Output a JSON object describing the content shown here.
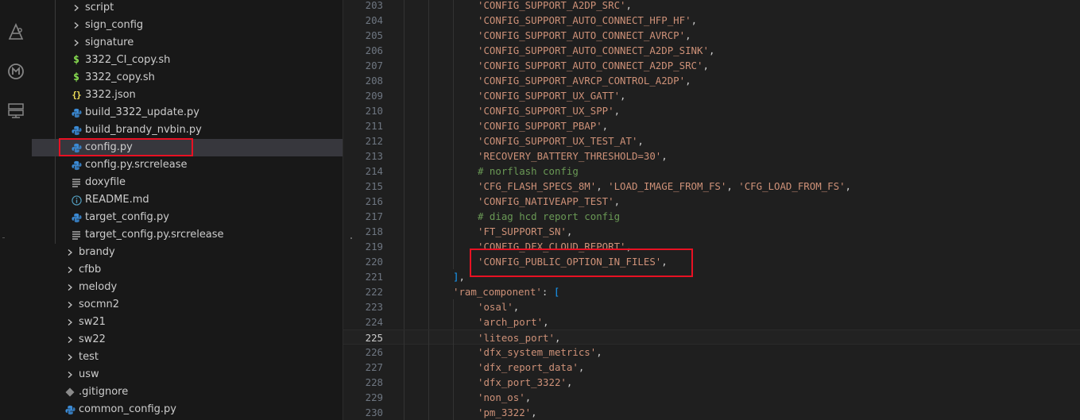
{
  "activity_bar": {
    "icons": [
      "source-control-graph-icon",
      "codebuddy-icon",
      "remote-explorer-icon"
    ]
  },
  "explorer": {
    "items": [
      {
        "label": "script",
        "type": "folder",
        "level": 2,
        "expanded": false
      },
      {
        "label": "sign_config",
        "type": "folder",
        "level": 2,
        "expanded": false
      },
      {
        "label": "signature",
        "type": "folder",
        "level": 2,
        "expanded": false
      },
      {
        "label": "3322_CI_copy.sh",
        "type": "shell",
        "level": 2
      },
      {
        "label": "3322_copy.sh",
        "type": "shell",
        "level": 2
      },
      {
        "label": "3322.json",
        "type": "json",
        "level": 2
      },
      {
        "label": "build_3322_update.py",
        "type": "python",
        "level": 2
      },
      {
        "label": "build_brandy_nvbin.py",
        "type": "python",
        "level": 2
      },
      {
        "label": "config.py",
        "type": "python",
        "level": 2,
        "selected": true
      },
      {
        "label": "config.py.srcrelease",
        "type": "python",
        "level": 2
      },
      {
        "label": "doxyfile",
        "type": "text",
        "level": 2
      },
      {
        "label": "README.md",
        "type": "info",
        "level": 2
      },
      {
        "label": "target_config.py",
        "type": "python",
        "level": 2
      },
      {
        "label": "target_config.py.srcrelease",
        "type": "text",
        "level": 2
      },
      {
        "label": "brandy",
        "type": "folder",
        "level": 1,
        "expanded": false
      },
      {
        "label": "cfbb",
        "type": "folder",
        "level": 1,
        "expanded": false
      },
      {
        "label": "melody",
        "type": "folder",
        "level": 1,
        "expanded": false
      },
      {
        "label": "socmn2",
        "type": "folder",
        "level": 1,
        "expanded": false
      },
      {
        "label": "sw21",
        "type": "folder",
        "level": 1,
        "expanded": false
      },
      {
        "label": "sw22",
        "type": "folder",
        "level": 1,
        "expanded": false
      },
      {
        "label": "test",
        "type": "folder",
        "level": 1,
        "expanded": false
      },
      {
        "label": "usw",
        "type": "folder",
        "level": 1,
        "expanded": false
      },
      {
        "label": ".gitignore",
        "type": "git",
        "level": 1
      },
      {
        "label": "common_config.py",
        "type": "python",
        "level": 1
      }
    ]
  },
  "editor": {
    "current_line": 225,
    "lines": [
      {
        "num": "203",
        "indent": 3,
        "tokens": [
          {
            "t": "'CONFIG_SUPPORT_A2DP_SRC'",
            "c": "str"
          },
          {
            "t": ",",
            "c": "p"
          }
        ]
      },
      {
        "num": "204",
        "indent": 3,
        "tokens": [
          {
            "t": "'CONFIG_SUPPORT_AUTO_CONNECT_HFP_HF'",
            "c": "str"
          },
          {
            "t": ",",
            "c": "p"
          }
        ]
      },
      {
        "num": "205",
        "indent": 3,
        "tokens": [
          {
            "t": "'CONFIG_SUPPORT_AUTO_CONNECT_AVRCP'",
            "c": "str"
          },
          {
            "t": ",",
            "c": "p"
          }
        ]
      },
      {
        "num": "206",
        "indent": 3,
        "tokens": [
          {
            "t": "'CONFIG_SUPPORT_AUTO_CONNECT_A2DP_SINK'",
            "c": "str"
          },
          {
            "t": ",",
            "c": "p"
          }
        ]
      },
      {
        "num": "207",
        "indent": 3,
        "tokens": [
          {
            "t": "'CONFIG_SUPPORT_AUTO_CONNECT_A2DP_SRC'",
            "c": "str"
          },
          {
            "t": ",",
            "c": "p"
          }
        ]
      },
      {
        "num": "208",
        "indent": 3,
        "tokens": [
          {
            "t": "'CONFIG_SUPPORT_AVRCP_CONTROL_A2DP'",
            "c": "str"
          },
          {
            "t": ",",
            "c": "p"
          }
        ]
      },
      {
        "num": "209",
        "indent": 3,
        "tokens": [
          {
            "t": "'CONFIG_SUPPORT_UX_GATT'",
            "c": "str"
          },
          {
            "t": ",",
            "c": "p"
          }
        ]
      },
      {
        "num": "210",
        "indent": 3,
        "tokens": [
          {
            "t": "'CONFIG_SUPPORT_UX_SPP'",
            "c": "str"
          },
          {
            "t": ",",
            "c": "p"
          }
        ]
      },
      {
        "num": "211",
        "indent": 3,
        "tokens": [
          {
            "t": "'CONFIG_SUPPORT_PBAP'",
            "c": "str"
          },
          {
            "t": ",",
            "c": "p"
          }
        ]
      },
      {
        "num": "212",
        "indent": 3,
        "tokens": [
          {
            "t": "'CONFIG_SUPPORT_UX_TEST_AT'",
            "c": "str"
          },
          {
            "t": ",",
            "c": "p"
          }
        ]
      },
      {
        "num": "213",
        "indent": 3,
        "tokens": [
          {
            "t": "'RECOVERY_BATTERY_THRESHOLD=30'",
            "c": "str"
          },
          {
            "t": ",",
            "c": "p"
          }
        ]
      },
      {
        "num": "214",
        "indent": 3,
        "tokens": [
          {
            "t": "# norflash config",
            "c": "cm"
          }
        ]
      },
      {
        "num": "215",
        "indent": 3,
        "tokens": [
          {
            "t": "'CFG_FLASH_SPECS_8M'",
            "c": "str"
          },
          {
            "t": ", ",
            "c": "p"
          },
          {
            "t": "'LOAD_IMAGE_FROM_FS'",
            "c": "str"
          },
          {
            "t": ", ",
            "c": "p"
          },
          {
            "t": "'CFG_LOAD_FROM_FS'",
            "c": "str"
          },
          {
            "t": ",",
            "c": "p"
          }
        ]
      },
      {
        "num": "216",
        "indent": 3,
        "tokens": [
          {
            "t": "'CONFIG_NATIVEAPP_TEST'",
            "c": "str"
          },
          {
            "t": ",",
            "c": "p"
          }
        ]
      },
      {
        "num": "217",
        "indent": 3,
        "tokens": [
          {
            "t": "# diag hcd report config",
            "c": "cm"
          }
        ]
      },
      {
        "num": "218",
        "indent": 3,
        "tokens": [
          {
            "t": "'FT_SUPPORT_SN'",
            "c": "str"
          },
          {
            "t": ",",
            "c": "p"
          }
        ]
      },
      {
        "num": "219",
        "indent": 3,
        "tokens": [
          {
            "t": "'CONFIG_DFX_CLOUD_REPORT'",
            "c": "str"
          },
          {
            "t": ",",
            "c": "p"
          }
        ]
      },
      {
        "num": "220",
        "indent": 3,
        "tokens": [
          {
            "t": "'CONFIG_PUBLIC_OPTION_IN_FILES'",
            "c": "str"
          },
          {
            "t": ",",
            "c": "p"
          }
        ]
      },
      {
        "num": "221",
        "indent": 2,
        "tokens": [
          {
            "t": "]",
            "c": "br2"
          },
          {
            "t": ",",
            "c": "p"
          }
        ]
      },
      {
        "num": "222",
        "indent": 2,
        "tokens": [
          {
            "t": "'ram_component'",
            "c": "str"
          },
          {
            "t": ": ",
            "c": "p"
          },
          {
            "t": "[",
            "c": "br2"
          }
        ]
      },
      {
        "num": "223",
        "indent": 3,
        "tokens": [
          {
            "t": "'osal'",
            "c": "str"
          },
          {
            "t": ",",
            "c": "p"
          }
        ]
      },
      {
        "num": "224",
        "indent": 3,
        "tokens": [
          {
            "t": "'arch_port'",
            "c": "str"
          },
          {
            "t": ",",
            "c": "p"
          }
        ]
      },
      {
        "num": "225",
        "indent": 3,
        "tokens": [
          {
            "t": "'liteos_port'",
            "c": "str"
          },
          {
            "t": ",",
            "c": "p"
          }
        ]
      },
      {
        "num": "226",
        "indent": 3,
        "tokens": [
          {
            "t": "'dfx_system_metrics'",
            "c": "str"
          },
          {
            "t": ",",
            "c": "p"
          }
        ]
      },
      {
        "num": "227",
        "indent": 3,
        "tokens": [
          {
            "t": "'dfx_report_data'",
            "c": "str"
          },
          {
            "t": ",",
            "c": "p"
          }
        ]
      },
      {
        "num": "228",
        "indent": 3,
        "tokens": [
          {
            "t": "'dfx_port_3322'",
            "c": "str"
          },
          {
            "t": ",",
            "c": "p"
          }
        ]
      },
      {
        "num": "229",
        "indent": 3,
        "tokens": [
          {
            "t": "'non_os'",
            "c": "str"
          },
          {
            "t": ",",
            "c": "p"
          }
        ]
      },
      {
        "num": "230",
        "indent": 3,
        "tokens": [
          {
            "t": "'pm_3322'",
            "c": "str"
          },
          {
            "t": ",",
            "c": "p"
          }
        ]
      }
    ]
  },
  "colors": {
    "string": "#ce9178",
    "comment": "#6a9955",
    "bracket": "#179fff",
    "highlight_box": "#e81123",
    "python_icon": "#3b8bd6",
    "shell_icon": "#89e051",
    "json_icon": "#f1e05a"
  }
}
